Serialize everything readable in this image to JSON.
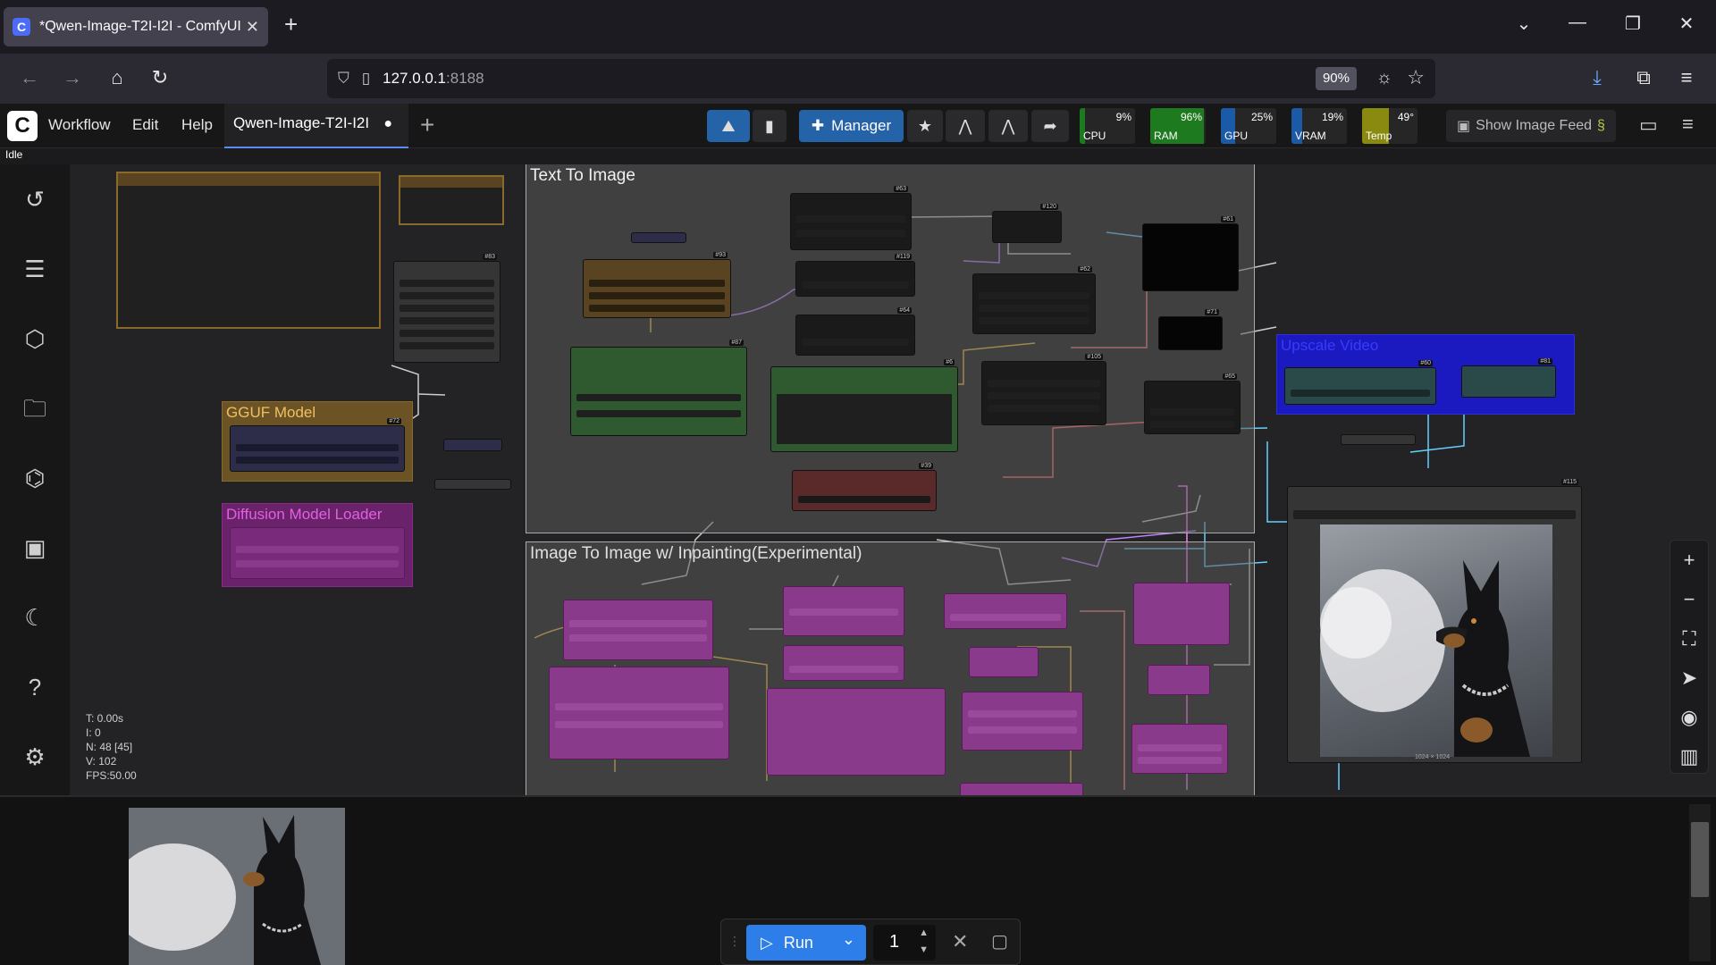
{
  "browser": {
    "tab_title": "*Qwen-Image-T2I-I2I - ComfyUI",
    "url_host": "127.0.0.1",
    "url_port": ":8188",
    "zoom": "90%"
  },
  "menu": {
    "workflow": "Workflow",
    "edit": "Edit",
    "help": "Help",
    "active_tab": "Qwen-Image-T2I-I2I",
    "manager": "Manager",
    "show_feed": "Show Image Feed"
  },
  "monitors": [
    {
      "label": "CPU",
      "value": "9%",
      "percent": 9,
      "color": "#1e7a1e"
    },
    {
      "label": "RAM",
      "value": "96%",
      "percent": 96,
      "color": "#1e7a1e"
    },
    {
      "label": "GPU",
      "value": "25%",
      "percent": 25,
      "color": "#1a5aa6"
    },
    {
      "label": "VRAM",
      "value": "19%",
      "percent": 19,
      "color": "#1a5aa6"
    },
    {
      "label": "Temp",
      "value": "49°",
      "percent": 49,
      "color": "#8a8a10"
    }
  ],
  "status": "Idle",
  "groups": {
    "t2i": "Text To Image",
    "i2i": "Image To Image w/ Inpainting(Experimental)",
    "gguf": "GGUF Model",
    "diffusion": "Diffusion Model Loader",
    "upscale": "Upscale Video"
  },
  "stats": {
    "t": "T: 0.00s",
    "i": "I: 0",
    "n": "N: 48 [45]",
    "v": "V: 102",
    "fps": "FPS:50.00"
  },
  "preview_size": "1024 × 1024",
  "run": {
    "label": "Run",
    "count": "1"
  }
}
